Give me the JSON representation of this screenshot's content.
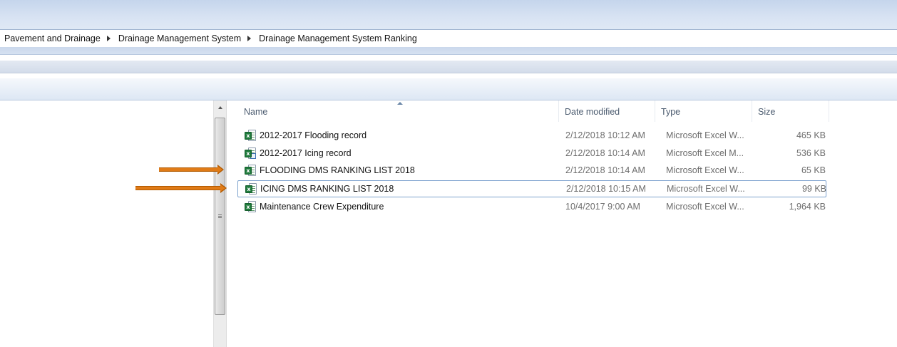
{
  "breadcrumb": {
    "items": [
      "Pavement and Drainage",
      "Drainage Management System",
      "Drainage Management System Ranking"
    ]
  },
  "columns": {
    "name": "Name",
    "date": "Date modified",
    "type": "Type",
    "size": "Size"
  },
  "sort": {
    "column": "Name",
    "direction": "ascending"
  },
  "files": [
    {
      "name": "2012-2017 Flooding record",
      "date": "2/12/2018 10:12 AM",
      "type": "Microsoft Excel W...",
      "size": "465 KB",
      "icon": "excel-workbook-icon"
    },
    {
      "name": "2012-2017 Icing record",
      "date": "2/12/2018 10:14 AM",
      "type": "Microsoft Excel M...",
      "size": "536 KB",
      "icon": "excel-macro-workbook-icon"
    },
    {
      "name": "FLOODING DMS RANKING LIST 2018",
      "date": "2/12/2018 10:14 AM",
      "type": "Microsoft Excel W...",
      "size": "65 KB",
      "icon": "excel-workbook-icon"
    },
    {
      "name": "ICING DMS RANKING LIST 2018",
      "date": "2/12/2018 10:15 AM",
      "type": "Microsoft Excel W...",
      "size": "99 KB",
      "icon": "excel-workbook-icon",
      "selected": true
    },
    {
      "name": "Maintenance Crew Expenditure",
      "date": "10/4/2017 9:00 AM",
      "type": "Microsoft Excel W...",
      "size": "1,964 KB",
      "icon": "excel-workbook-icon"
    }
  ],
  "annotations": {
    "arrow_color": "#e07b17",
    "arrows_point_to": [
      "FLOODING DMS RANKING LIST 2018",
      "ICING DMS RANKING LIST 2018"
    ]
  },
  "colors": {
    "title_band": "#c5d5ec",
    "selection_border": "#7da2ce",
    "header_text": "#4a5a6e",
    "excel_green": "#1f7a3c"
  }
}
